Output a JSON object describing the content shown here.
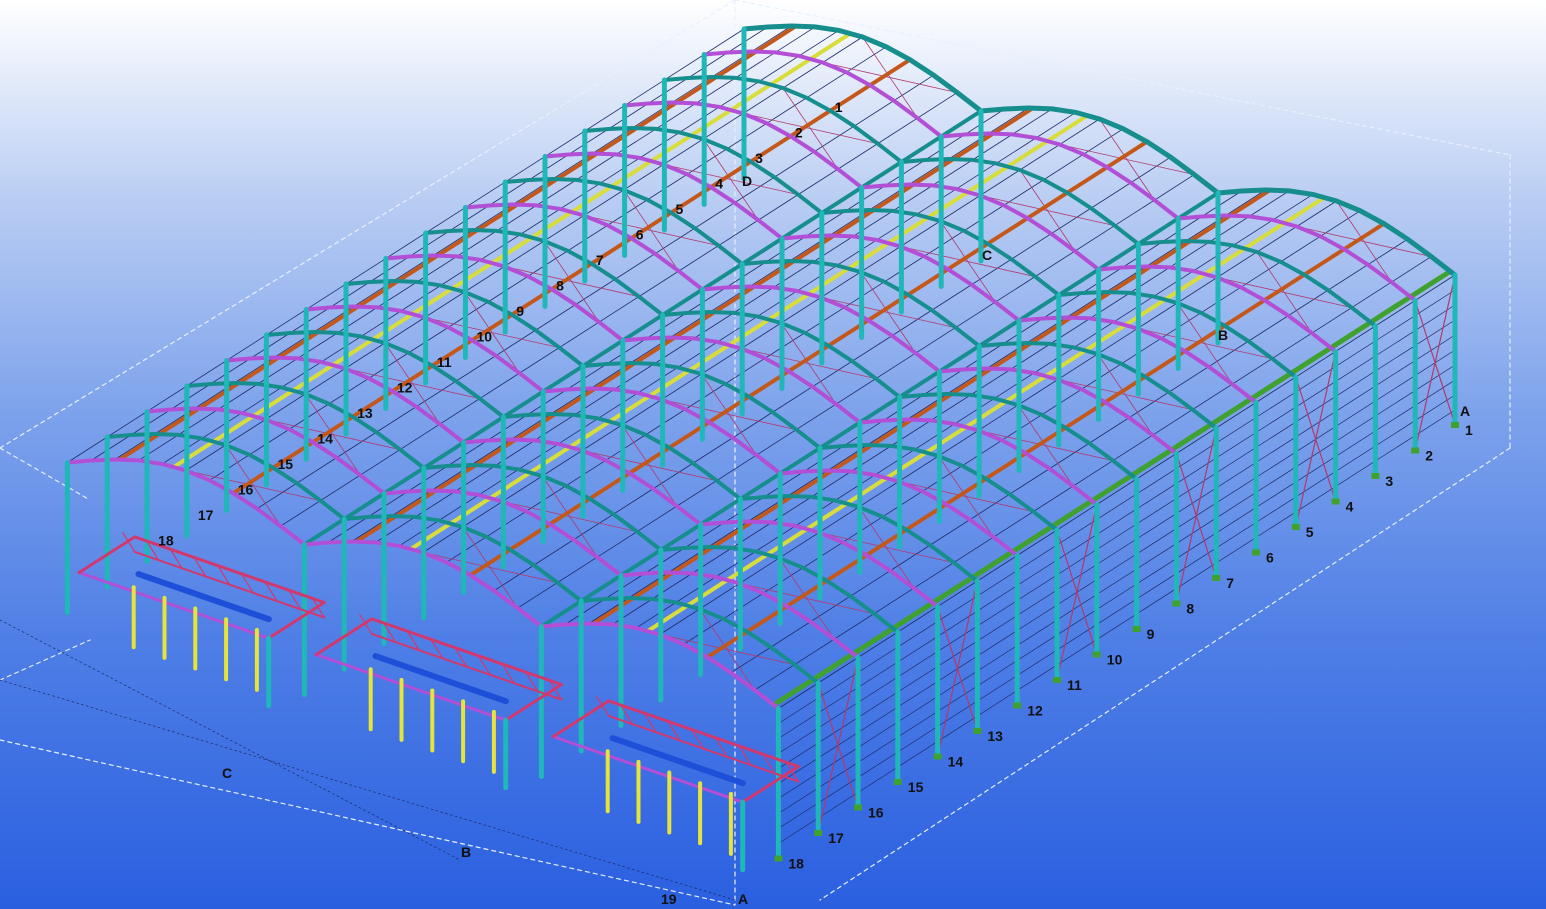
{
  "viewport": {
    "background_top": "#ffffff",
    "background_bottom": "#2a5fe0"
  },
  "colors": {
    "column": "#1fb7b7",
    "rafter_teal": "#168e8e",
    "rafter_purple": "#b24fd6",
    "purlin_orange": "#c4581a",
    "strut_yellow": "#d9dd3a",
    "bracing": "#b03a6e",
    "purlin_lines": "#1c2a66",
    "post_yellow": "#e4e43a",
    "beam_blue": "#1e4fd8",
    "truss_red": "#d2386e",
    "eave_green": "#3fa12e",
    "work_area": "#e8f0ff"
  },
  "grid_labels_left": [
    "1",
    "2",
    "3",
    "4",
    "5",
    "6",
    "7",
    "8",
    "9",
    "10",
    "11",
    "12",
    "13",
    "14",
    "15",
    "16",
    "17",
    "18"
  ],
  "grid_labels_right": [
    "1",
    "2",
    "3",
    "4",
    "5",
    "6",
    "7",
    "8",
    "9",
    "10",
    "11",
    "12",
    "13",
    "14",
    "15",
    "16",
    "17",
    "18"
  ],
  "grid_label_19": "19",
  "grid_letters_top": [
    "D",
    "C",
    "B",
    "A"
  ],
  "grid_letters_bottom": [
    "C",
    "B",
    "A"
  ]
}
